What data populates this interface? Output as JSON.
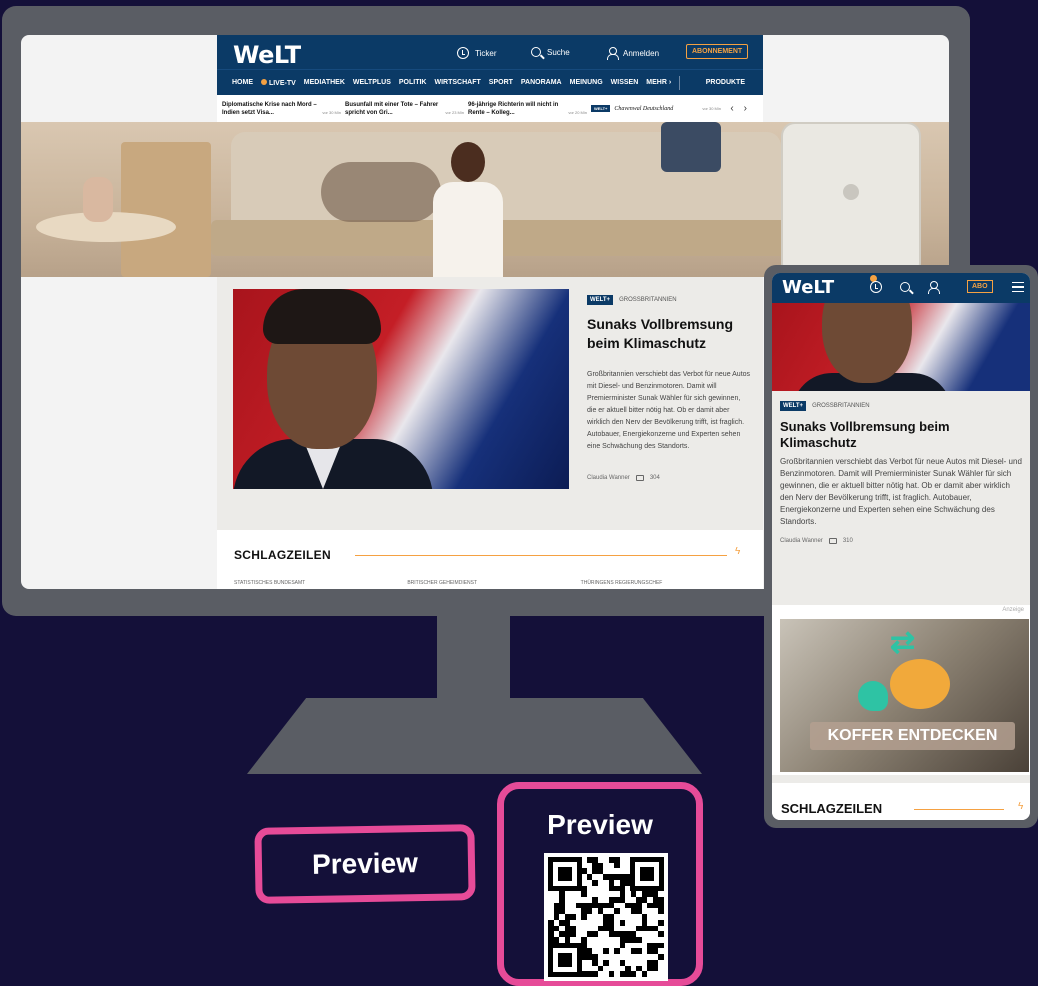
{
  "desktop": {
    "logo": "WeLT",
    "header": {
      "ticker": "Ticker",
      "search": "Suche",
      "login": "Anmelden",
      "subscribe": "ABONNEMENT"
    },
    "nav": [
      "HOME",
      "LIVE-TV",
      "MEDIATHEK",
      "WELTPLUS",
      "POLITIK",
      "WIRTSCHAFT",
      "SPORT",
      "PANORAMA",
      "MEINUNG",
      "WISSEN",
      "MEHR"
    ],
    "nav_products": "PRODUKTE",
    "teasers": [
      {
        "title": "Diplomatische Krise nach Mord – Indien setzt Visa...",
        "age": "vor 30 Min"
      },
      {
        "title": "Busunfall mit einer Tote – Fahrer spricht von Gri...",
        "age": "vor 23 Min"
      },
      {
        "title": "96-jährige Richterin will nicht in Rente – Kolleg...",
        "age": "vor 20 Min"
      }
    ],
    "teaser_ad": {
      "badge": "WELT+",
      "text": "Chavenwal Deutschland",
      "age": "vor 30 Min"
    },
    "article": {
      "badge": "WELT+",
      "tag": "GROSSBRITANNIEN",
      "title": "Sunaks Vollbremsung beim Klimaschutz",
      "body": "Großbritannien verschiebt das Verbot für neue Autos mit Diesel- und Benzinmotoren. Damit will Premierminister Sunak Wähler für sich gewinnen, die er aktuell bitter nötig hat. Ob er damit aber wirklich den Nerv der Bevölkerung trifft, ist fraglich. Autobauer, Energiekonzerne und Experten sehen eine Schwächung des Standorts.",
      "author": "Claudia Wanner",
      "comments": "304"
    },
    "schlagzeilen": {
      "title": "SCHLAGZEILEN",
      "categories": [
        "STATISTISCHES BUNDESAMT",
        "BRITISCHER GEHEIMDIENST",
        "THÜRINGENS REGIERUNGSCHEF"
      ]
    }
  },
  "mobile": {
    "logo": "WeLT",
    "abo": "ABO",
    "article": {
      "badge": "WELT+",
      "tag": "GROSSBRITANNIEN",
      "title": "Sunaks Vollbremsung beim Klimaschutz",
      "body": "Großbritannien verschiebt das Verbot für neue Autos mit Diesel- und Benzinmotoren. Damit will Premierminister Sunak Wähler für sich gewinnen, die er aktuell bitter nötig hat. Ob er damit aber wirklich den Nerv der Bevölkerung trifft, ist fraglich. Autobauer, Energiekonzerne und Experten sehen eine Schwächung des Standorts.",
      "author": "Claudia Wanner",
      "comments": "310"
    },
    "ad": {
      "label": "Anzeige",
      "cta": "KOFFER ENTDECKEN"
    },
    "schlagzeilen": "SCHLAGZEILEN"
  },
  "buttons": {
    "preview": "Preview",
    "preview_qr": "Preview"
  },
  "colors": {
    "background": "#141039",
    "device": "#5a5d64",
    "welt_blue": "#0b3a66",
    "accent_orange": "#f5a142",
    "highlight_pink": "#e64b98"
  }
}
